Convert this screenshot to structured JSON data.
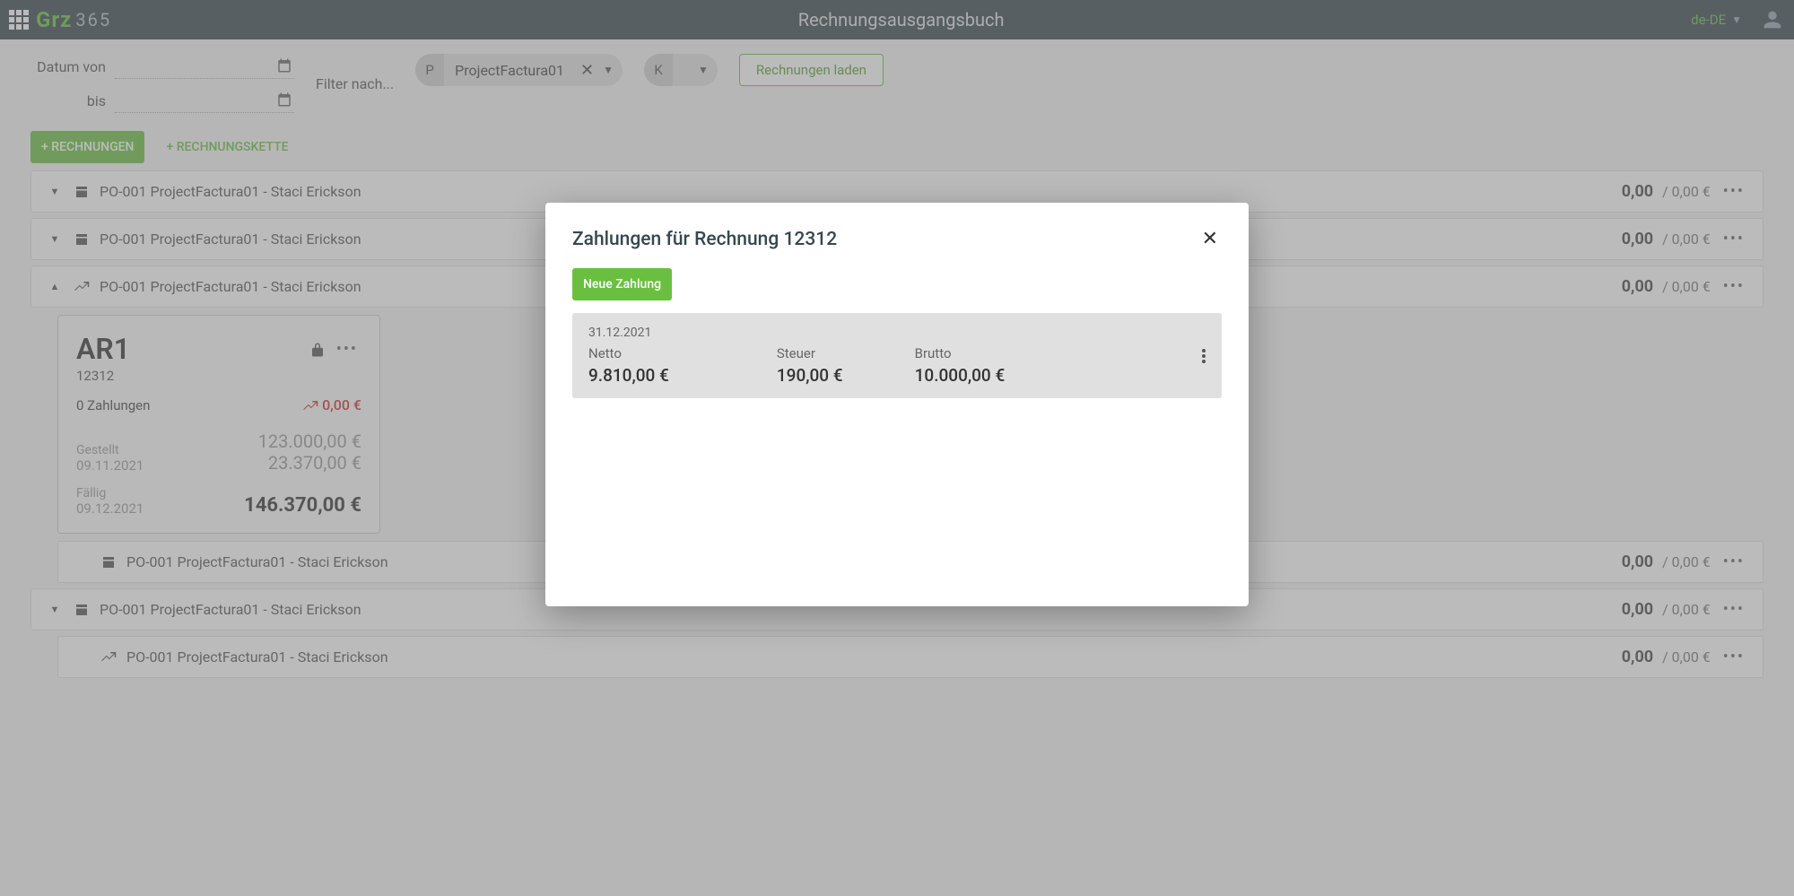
{
  "header": {
    "logo_prefix": "Grz",
    "logo_suffix": "365",
    "title": "Rechnungsausgangsbuch",
    "locale": "de-DE"
  },
  "filters": {
    "date_from_label": "Datum von",
    "date_to_label": "bis",
    "filter_label": "Filter nach...",
    "chip_p_badge": "P",
    "chip_p_text": "ProjectFactura01",
    "chip_k_badge": "K",
    "load_button": "Rechnungen laden"
  },
  "actions": {
    "add_invoices": "+ RECHNUNGEN",
    "add_chain": "+ RECHNUNGSKETTE"
  },
  "rows": [
    {
      "title": "PO-001 ProjectFactura01 - Staci Erickson",
      "amount": "0,00",
      "sub": "/ 0,00 €",
      "icon": "box",
      "chevron": "down",
      "indent": false,
      "expanded": false
    },
    {
      "title": "PO-001 ProjectFactura01 - Staci Erickson",
      "amount": "0,00",
      "sub": "/ 0,00 €",
      "icon": "box",
      "chevron": "down",
      "indent": false,
      "expanded": false
    },
    {
      "title": "PO-001 ProjectFactura01 - Staci Erickson",
      "amount": "0,00",
      "sub": "/ 0,00 €",
      "icon": "trend",
      "chevron": "up",
      "indent": false,
      "expanded": true
    },
    {
      "title": "PO-001 ProjectFactura01 - Staci Erickson",
      "amount": "0,00",
      "sub": "/ 0,00 €",
      "icon": "box",
      "chevron": "none",
      "indent": true,
      "expanded": false
    },
    {
      "title": "PO-001 ProjectFactura01 - Staci Erickson",
      "amount": "0,00",
      "sub": "/ 0,00 €",
      "icon": "box",
      "chevron": "down",
      "indent": false,
      "expanded": false
    },
    {
      "title": "PO-001 ProjectFactura01 - Staci Erickson",
      "amount": "0,00",
      "sub": "/ 0,00 €",
      "icon": "trend",
      "chevron": "none",
      "indent": true,
      "expanded": false
    }
  ],
  "card": {
    "title": "AR1",
    "subtitle": "12312",
    "payments_text": "0 Zahlungen",
    "trend_amount": "0,00 €",
    "issued_label": "Gestellt",
    "issued_date": "09.11.2021",
    "net_amount": "123.000,00 €",
    "tax_amount": "23.370,00 €",
    "due_label": "Fällig",
    "due_date": "09.12.2021",
    "total_amount": "146.370,00 €"
  },
  "modal": {
    "title": "Zahlungen für Rechnung 12312",
    "new_payment_btn": "Neue Zahlung",
    "payment": {
      "date": "31.12.2021",
      "netto_label": "Netto",
      "netto_value": "9.810,00 €",
      "steuer_label": "Steuer",
      "steuer_value": "190,00 €",
      "brutto_label": "Brutto",
      "brutto_value": "10.000,00 €"
    }
  }
}
